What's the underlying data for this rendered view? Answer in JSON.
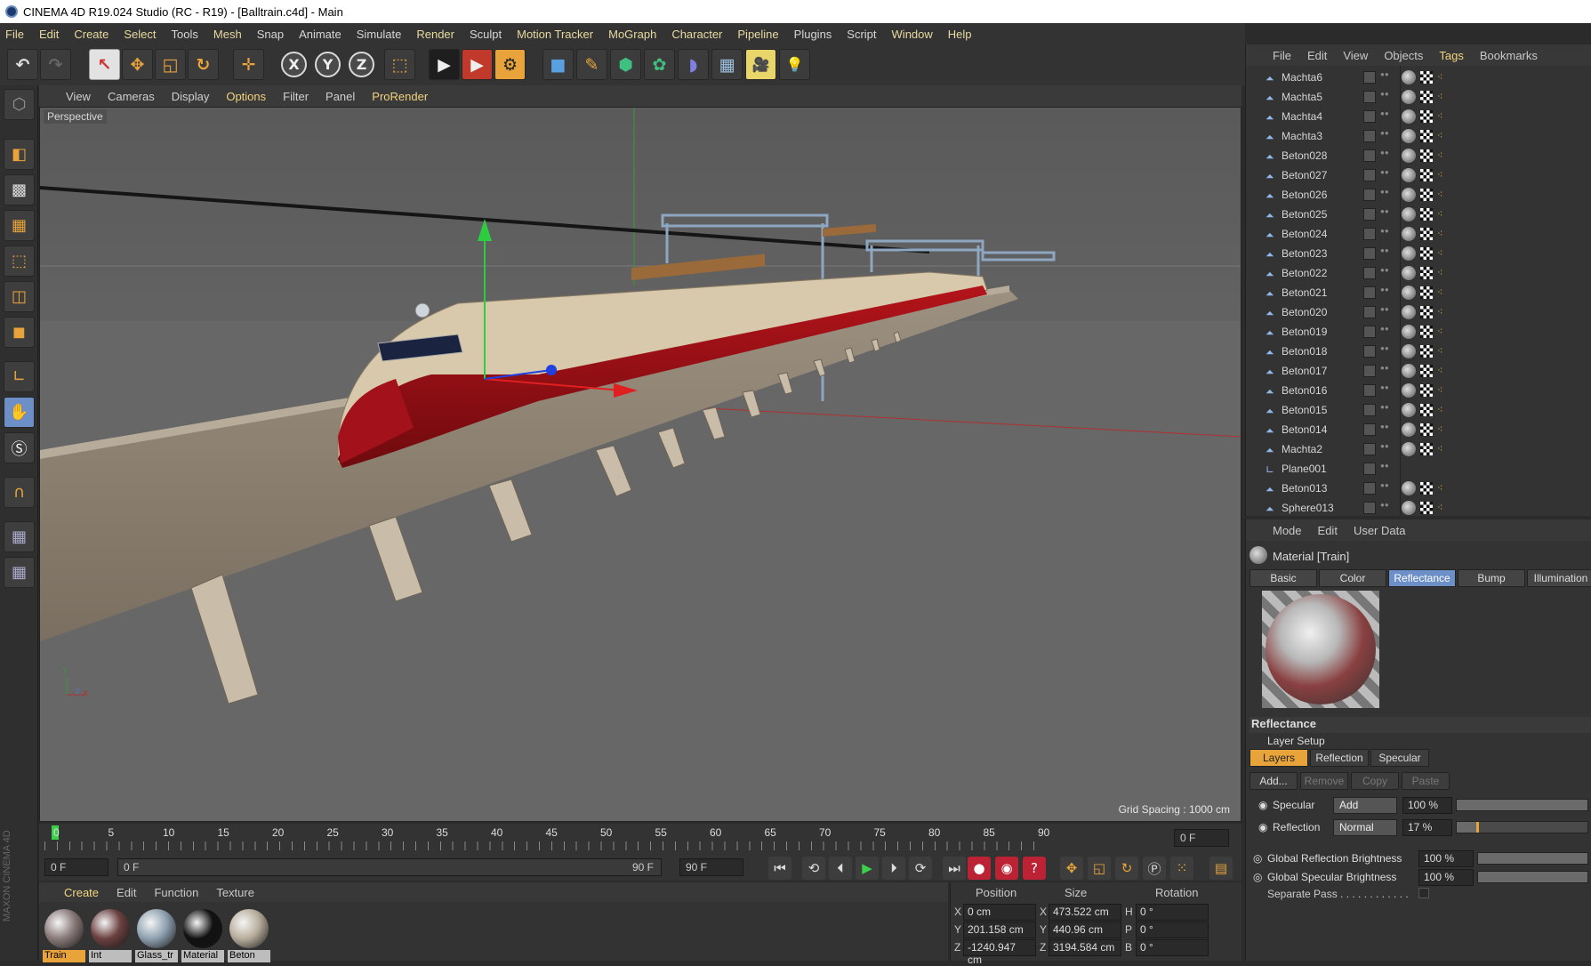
{
  "window_title": "CINEMA 4D R19.024 Studio (RC - R19) - [Balltrain.c4d] - Main",
  "menubar": [
    "File",
    "Edit",
    "Create",
    "Select",
    "Tools",
    "Mesh",
    "Snap",
    "Animate",
    "Simulate",
    "Render",
    "Sculpt",
    "Motion Tracker",
    "MoGraph",
    "Character",
    "Pipeline",
    "Plugins",
    "Script",
    "Window",
    "Help"
  ],
  "toolbar": {
    "undo": "↶",
    "redo": "↷",
    "live_select": "↖",
    "move": "✥",
    "scale": "◱",
    "rotate": "↻",
    "last_tool": "✛",
    "x": "X",
    "y": "Y",
    "z": "Z",
    "coord": "⬚",
    "render_view": "▶",
    "render_pv": "▶",
    "render_settings": "⚙",
    "cube": "■",
    "pen": "✎",
    "subdiv": "⬢",
    "cloner": "✿",
    "deformer": "◗",
    "floor": "▦",
    "camera": "🎥",
    "light": "💡"
  },
  "viewport_menu": [
    "View",
    "Cameras",
    "Display",
    "Options",
    "Filter",
    "Panel",
    "ProRender"
  ],
  "viewport": {
    "label": "Perspective",
    "grid_spacing": "Grid Spacing : 1000 cm",
    "axis_y": "Y",
    "axis_x": "X",
    "axis_z": "Z"
  },
  "timeline": {
    "ticks": [
      "0",
      "5",
      "10",
      "15",
      "20",
      "25",
      "30",
      "35",
      "40",
      "45",
      "50",
      "55",
      "60",
      "65",
      "70",
      "75",
      "80",
      "85",
      "90"
    ],
    "current_frame_right": "0 F",
    "start_field": "0 F",
    "range_start": "0 F",
    "range_end": "90 F",
    "end_field": "90 F"
  },
  "playback": [
    "⏮",
    "⟲",
    "⏴",
    "▶",
    "⏵",
    "⟳",
    "⏭"
  ],
  "material_manager": {
    "menu": [
      "Create",
      "Edit",
      "Function",
      "Texture"
    ],
    "materials": [
      {
        "name": "Train",
        "selected": true,
        "color": "#8a7a7a"
      },
      {
        "name": "Int",
        "selected": false,
        "color": "#6b4040"
      },
      {
        "name": "Glass_tr",
        "selected": false,
        "color": "#8ea0b0"
      },
      {
        "name": "Material",
        "selected": false,
        "color": "#111111"
      },
      {
        "name": "Beton",
        "selected": false,
        "color": "#b8ad9c"
      }
    ]
  },
  "coordinates": {
    "headers": [
      "Position",
      "Size",
      "Rotation"
    ],
    "rows": [
      {
        "axis": "X",
        "pos": "0 cm",
        "size_axis": "X",
        "size": "473.522 cm",
        "rot_axis": "H",
        "rot": "0 °"
      },
      {
        "axis": "Y",
        "pos": "201.158 cm",
        "size_axis": "Y",
        "size": "440.96 cm",
        "rot_axis": "P",
        "rot": "0 °"
      },
      {
        "axis": "Z",
        "pos": "-1240.947 cm",
        "size_axis": "Z",
        "size": "3194.584 cm",
        "rot_axis": "B",
        "rot": "0 °"
      }
    ]
  },
  "object_manager": {
    "menu": [
      "File",
      "Edit",
      "View",
      "Objects",
      "Tags",
      "Bookmarks"
    ],
    "objects": [
      {
        "name": "Machta6",
        "type": "bone",
        "tags": true
      },
      {
        "name": "Machta5",
        "type": "bone",
        "tags": true
      },
      {
        "name": "Machta4",
        "type": "bone",
        "tags": true
      },
      {
        "name": "Machta3",
        "type": "bone",
        "tags": true
      },
      {
        "name": "Beton028",
        "type": "bone",
        "tags": true
      },
      {
        "name": "Beton027",
        "type": "bone",
        "tags": true
      },
      {
        "name": "Beton026",
        "type": "bone",
        "tags": true
      },
      {
        "name": "Beton025",
        "type": "bone",
        "tags": true
      },
      {
        "name": "Beton024",
        "type": "bone",
        "tags": true
      },
      {
        "name": "Beton023",
        "type": "bone",
        "tags": true
      },
      {
        "name": "Beton022",
        "type": "bone",
        "tags": true
      },
      {
        "name": "Beton021",
        "type": "bone",
        "tags": true
      },
      {
        "name": "Beton020",
        "type": "bone",
        "tags": true
      },
      {
        "name": "Beton019",
        "type": "bone",
        "tags": true
      },
      {
        "name": "Beton018",
        "type": "bone",
        "tags": true
      },
      {
        "name": "Beton017",
        "type": "bone",
        "tags": true
      },
      {
        "name": "Beton016",
        "type": "bone",
        "tags": true
      },
      {
        "name": "Beton015",
        "type": "bone",
        "tags": true
      },
      {
        "name": "Beton014",
        "type": "bone",
        "tags": true
      },
      {
        "name": "Machta2",
        "type": "bone",
        "tags": true
      },
      {
        "name": "Plane001",
        "type": "plane",
        "tags": false
      },
      {
        "name": "Beton013",
        "type": "bone",
        "tags": true
      },
      {
        "name": "Sphere013",
        "type": "bone",
        "tags": true
      }
    ]
  },
  "attribute_manager": {
    "menu": [
      "Mode",
      "Edit",
      "User Data"
    ],
    "title": "Material [Train]",
    "tabs": [
      "Basic",
      "Color",
      "Reflectance",
      "Bump",
      "Illumination"
    ],
    "selected_tab": "Reflectance",
    "section": "Reflectance",
    "layer_setup": "Layer Setup",
    "layer_tabs": [
      "Layers",
      "Reflection",
      "Specular"
    ],
    "buttons": [
      "Add...",
      "Remove",
      "Copy",
      "Paste"
    ],
    "layers": [
      {
        "name": "Specular",
        "mode": "Add",
        "value": "100 %",
        "level": 1.0
      },
      {
        "name": "Reflection",
        "mode": "Normal",
        "value": "17 %",
        "level": 0.17
      }
    ],
    "global": [
      {
        "label": "Global Reflection Brightness",
        "value": "100 %",
        "level": 1.0
      },
      {
        "label": "Global Specular Brightness",
        "value": "100 %",
        "level": 1.0
      }
    ],
    "separate_pass": "Separate Pass . . . . . . . . . . . ."
  },
  "side_logo": "MAXON CINEMA 4D"
}
